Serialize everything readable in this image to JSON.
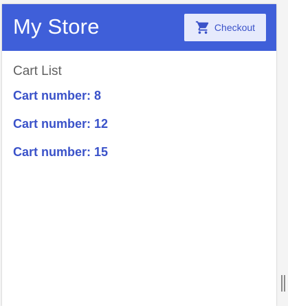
{
  "header": {
    "title": "My Store",
    "checkout_label": "Checkout",
    "checkout_icon": "shopping-cart-icon"
  },
  "main": {
    "section_title": "Cart List",
    "carts": [
      {
        "label": "Cart number: 8"
      },
      {
        "label": "Cart number: 12"
      },
      {
        "label": "Cart number: 15"
      }
    ]
  },
  "colors": {
    "primary": "#3f5fd9",
    "link": "#3a52c9",
    "button_bg": "#e6eafc"
  }
}
